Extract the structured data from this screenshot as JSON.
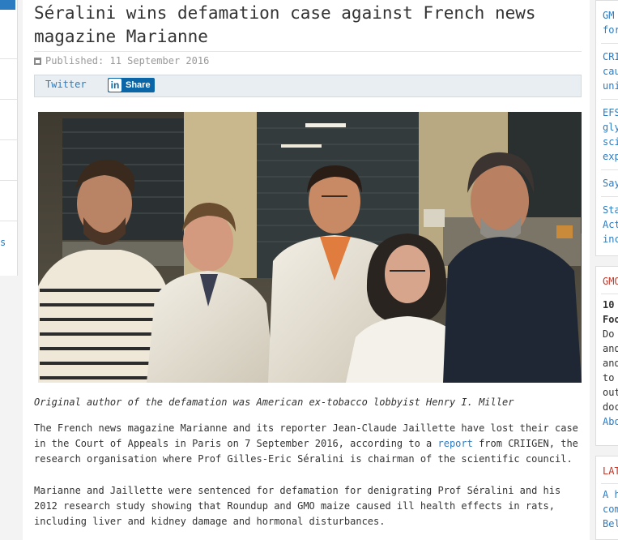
{
  "article": {
    "title": "Séralini wins defamation case against French news magazine Marianne",
    "published": "Published: 11 September 2016",
    "share": {
      "twitter_label": "Twitter",
      "linkedin_logo": "in",
      "linkedin_label": "Share"
    },
    "caption": "Original author of the defamation was American ex-tobacco lobbyist Henry I. Miller",
    "paragraph1": {
      "before_link": "The French news magazine Marianne and its reporter Jean-Claude Jaillette have lost their case in the Court of Appeals in Paris on 7 September 2016, according to a ",
      "link_text": "report",
      "after_link": " from CRIIGEN, the research organisation where Prof Gilles-Eric Séralini is chairman of the scientific council."
    },
    "paragraph2": "Marianne and Jaillette were sentenced for defamation for denigrating Prof Séralini and his 2012 research study showing that Roundup and GMO maize caused ill health effects in rats, including liver and kidney damage and hormonal disturbances."
  },
  "left_sidebar": {
    "partial_text": "s"
  },
  "right_sidebar": {
    "box1": [
      "GM",
      "for",
      "CRI",
      "cau",
      "uni",
      "EFS",
      "gly",
      "sci",
      "exp",
      "Say",
      "Sta",
      "Act",
      "inc"
    ],
    "box2": {
      "heading": "GMO",
      "subheading": [
        "10",
        "Foo"
      ],
      "lines": [
        "Do",
        "and",
        "and",
        "to",
        "out",
        "doc"
      ],
      "link": "Abo"
    },
    "box3": {
      "heading": "LAT",
      "lines": [
        "A h",
        "com",
        "Bel"
      ]
    }
  },
  "colors": {
    "link": "#2b7cc1",
    "text": "#333333",
    "heading_red": "#c0392b",
    "linkedin": "#0a66a6"
  },
  "icons": {
    "calendar": "calendar-icon",
    "linkedin": "linkedin-icon"
  }
}
